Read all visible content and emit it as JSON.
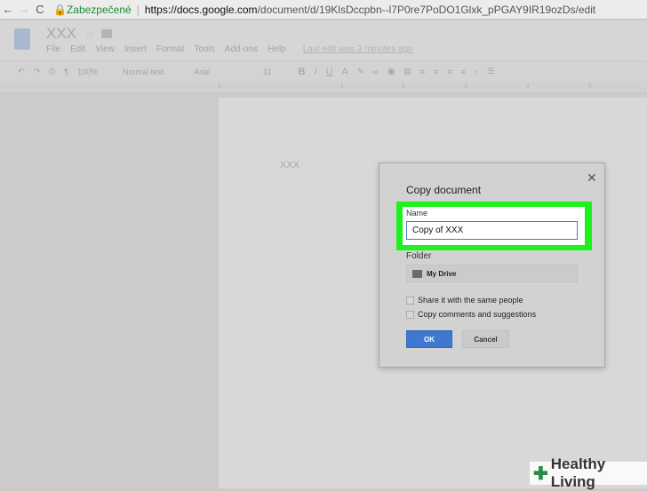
{
  "browser": {
    "secure_label": "Zabezpečené",
    "url_host": "https://docs.google.com",
    "url_path": "/document/d/19KlsDccpbn--l7P0re7PoDO1Glxk_pPGAY9IR19ozDs/edit"
  },
  "doc": {
    "title": "XXX",
    "menu": [
      "File",
      "Edit",
      "View",
      "Insert",
      "Format",
      "Tools",
      "Add-ons",
      "Help"
    ],
    "last_edit": "Last edit was 3 minutes ago",
    "body_text": "XXX"
  },
  "toolbar": {
    "zoom": "100%",
    "style": "Normal text",
    "font": "Arial",
    "size": "11",
    "bold": "B",
    "italic": "I",
    "underline": "U",
    "color": "A"
  },
  "ruler": {
    "marks": [
      "1",
      "1",
      "2",
      "3",
      "4",
      "5"
    ]
  },
  "dialog": {
    "title": "Copy document",
    "name_label": "Name",
    "name_value": "Copy of XXX",
    "folder_label": "Folder",
    "folder_value": "My Drive",
    "share_label": "Share it with the same people",
    "comments_label": "Copy comments and suggestions",
    "ok": "OK",
    "cancel": "Cancel"
  },
  "watermark": "Healthy Living"
}
